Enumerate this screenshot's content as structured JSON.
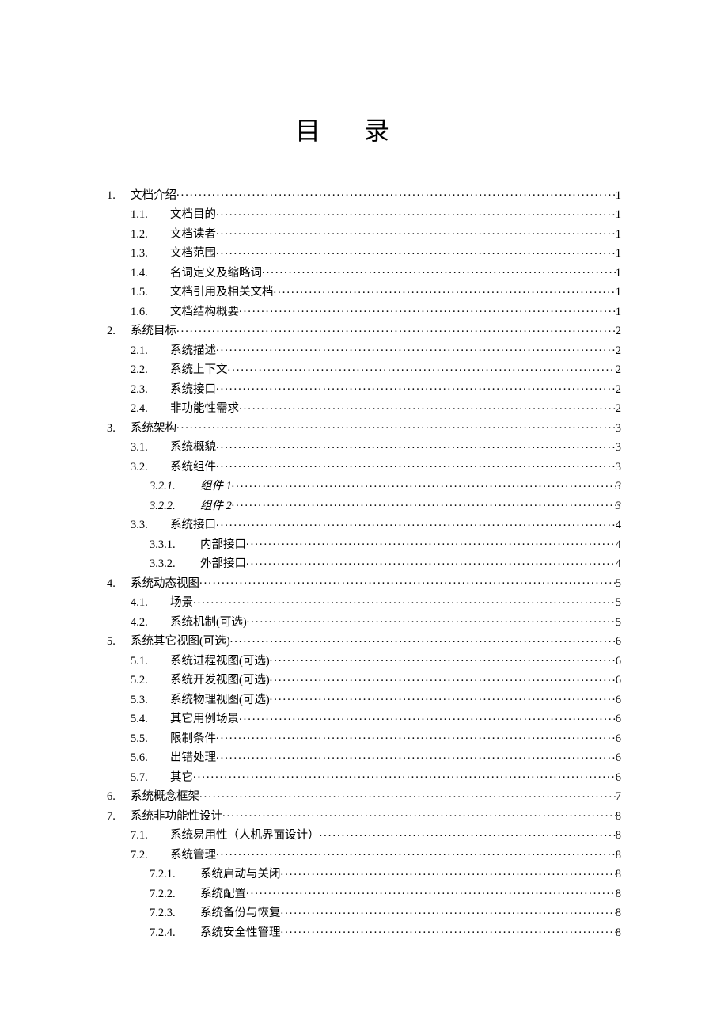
{
  "title": "目录",
  "entries": [
    {
      "level": 1,
      "num": "1.",
      "text": "文档介绍",
      "page": "1",
      "italic": false
    },
    {
      "level": 2,
      "num": "1.1.",
      "text": "文档目的",
      "page": "1",
      "italic": false
    },
    {
      "level": 2,
      "num": "1.2.",
      "text": "文档读者",
      "page": "1",
      "italic": false
    },
    {
      "level": 2,
      "num": "1.3.",
      "text": "文档范围",
      "page": "1",
      "italic": false
    },
    {
      "level": 2,
      "num": "1.4.",
      "text": "名词定义及缩略词",
      "page": "1",
      "italic": false
    },
    {
      "level": 2,
      "num": "1.5.",
      "text": "文档引用及相关文档",
      "page": "1",
      "italic": false
    },
    {
      "level": 2,
      "num": "1.6.",
      "text": "文档结构概要",
      "page": "1",
      "italic": false
    },
    {
      "level": 1,
      "num": "2.",
      "text": "系统目标",
      "page": "2",
      "italic": false
    },
    {
      "level": 2,
      "num": "2.1.",
      "text": "系统描述",
      "page": "2",
      "italic": false
    },
    {
      "level": 2,
      "num": "2.2.",
      "text": "系统上下文",
      "page": "2",
      "italic": false
    },
    {
      "level": 2,
      "num": "2.3.",
      "text": "系统接口",
      "page": "2",
      "italic": false
    },
    {
      "level": 2,
      "num": "2.4.",
      "text": "非功能性需求",
      "page": "2",
      "italic": false
    },
    {
      "level": 1,
      "num": "3.",
      "text": "系统架构",
      "page": "3",
      "italic": false
    },
    {
      "level": 2,
      "num": "3.1.",
      "text": "系统概貌",
      "page": "3",
      "italic": false
    },
    {
      "level": 2,
      "num": "3.2.",
      "text": "系统组件",
      "page": "3",
      "italic": false
    },
    {
      "level": 3,
      "num": "3.2.1.",
      "text": "组件 1",
      "page": "3",
      "italic": true
    },
    {
      "level": 3,
      "num": "3.2.2.",
      "text": "组件 2",
      "page": "3",
      "italic": true
    },
    {
      "level": 2,
      "num": "3.3.",
      "text": "系统接口",
      "page": "4",
      "italic": false
    },
    {
      "level": 3,
      "num": "3.3.1.",
      "text": "内部接口",
      "page": "4",
      "italic": false
    },
    {
      "level": 3,
      "num": "3.3.2.",
      "text": "外部接口",
      "page": "4",
      "italic": false
    },
    {
      "level": 1,
      "num": "4.",
      "text": "系统动态视图",
      "page": "5",
      "italic": false
    },
    {
      "level": 2,
      "num": "4.1.",
      "text": "场景",
      "page": "5",
      "italic": false
    },
    {
      "level": 2,
      "num": "4.2.",
      "text": "系统机制(可选)",
      "page": "5",
      "italic": false
    },
    {
      "level": 1,
      "num": "5.",
      "text": "系统其它视图(可选)",
      "page": "6",
      "italic": false
    },
    {
      "level": 2,
      "num": "5.1.",
      "text": "系统进程视图(可选)",
      "page": "6",
      "italic": false
    },
    {
      "level": 2,
      "num": "5.2.",
      "text": "系统开发视图(可选)",
      "page": "6",
      "italic": false
    },
    {
      "level": 2,
      "num": "5.3.",
      "text": "系统物理视图(可选)",
      "page": "6",
      "italic": false
    },
    {
      "level": 2,
      "num": "5.4.",
      "text": "其它用例场景",
      "page": "6",
      "italic": false
    },
    {
      "level": 2,
      "num": "5.5.",
      "text": "限制条件",
      "page": "6",
      "italic": false
    },
    {
      "level": 2,
      "num": "5.6.",
      "text": "出错处理",
      "page": "6",
      "italic": false
    },
    {
      "level": 2,
      "num": "5.7.",
      "text": "其它",
      "page": "6",
      "italic": false
    },
    {
      "level": 1,
      "num": "6.",
      "text": "系统概念框架",
      "page": "7",
      "italic": false
    },
    {
      "level": 1,
      "num": "7.",
      "text": "系统非功能性设计",
      "page": "8",
      "italic": false
    },
    {
      "level": 2,
      "num": "7.1.",
      "text": "系统易用性（人机界面设计）",
      "page": "8",
      "italic": false
    },
    {
      "level": 2,
      "num": "7.2.",
      "text": "系统管理",
      "page": "8",
      "italic": false
    },
    {
      "level": 3,
      "num": "7.2.1.",
      "text": "系统启动与关闭",
      "page": "8",
      "italic": false
    },
    {
      "level": 3,
      "num": "7.2.2.",
      "text": "系统配置",
      "page": "8",
      "italic": false
    },
    {
      "level": 3,
      "num": "7.2.3.",
      "text": "系统备份与恢复",
      "page": "8",
      "italic": false
    },
    {
      "level": 3,
      "num": "7.2.4.",
      "text": "系统安全性管理",
      "page": "8",
      "italic": false
    }
  ]
}
